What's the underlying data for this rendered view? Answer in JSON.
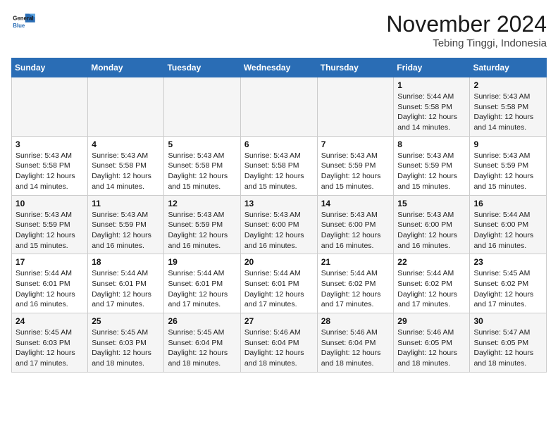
{
  "header": {
    "logo_line1": "General",
    "logo_line2": "Blue",
    "month": "November 2024",
    "location": "Tebing Tinggi, Indonesia"
  },
  "weekdays": [
    "Sunday",
    "Monday",
    "Tuesday",
    "Wednesday",
    "Thursday",
    "Friday",
    "Saturday"
  ],
  "weeks": [
    [
      {
        "day": "",
        "info": ""
      },
      {
        "day": "",
        "info": ""
      },
      {
        "day": "",
        "info": ""
      },
      {
        "day": "",
        "info": ""
      },
      {
        "day": "",
        "info": ""
      },
      {
        "day": "1",
        "info": "Sunrise: 5:44 AM\nSunset: 5:58 PM\nDaylight: 12 hours\nand 14 minutes."
      },
      {
        "day": "2",
        "info": "Sunrise: 5:43 AM\nSunset: 5:58 PM\nDaylight: 12 hours\nand 14 minutes."
      }
    ],
    [
      {
        "day": "3",
        "info": "Sunrise: 5:43 AM\nSunset: 5:58 PM\nDaylight: 12 hours\nand 14 minutes."
      },
      {
        "day": "4",
        "info": "Sunrise: 5:43 AM\nSunset: 5:58 PM\nDaylight: 12 hours\nand 14 minutes."
      },
      {
        "day": "5",
        "info": "Sunrise: 5:43 AM\nSunset: 5:58 PM\nDaylight: 12 hours\nand 15 minutes."
      },
      {
        "day": "6",
        "info": "Sunrise: 5:43 AM\nSunset: 5:58 PM\nDaylight: 12 hours\nand 15 minutes."
      },
      {
        "day": "7",
        "info": "Sunrise: 5:43 AM\nSunset: 5:59 PM\nDaylight: 12 hours\nand 15 minutes."
      },
      {
        "day": "8",
        "info": "Sunrise: 5:43 AM\nSunset: 5:59 PM\nDaylight: 12 hours\nand 15 minutes."
      },
      {
        "day": "9",
        "info": "Sunrise: 5:43 AM\nSunset: 5:59 PM\nDaylight: 12 hours\nand 15 minutes."
      }
    ],
    [
      {
        "day": "10",
        "info": "Sunrise: 5:43 AM\nSunset: 5:59 PM\nDaylight: 12 hours\nand 15 minutes."
      },
      {
        "day": "11",
        "info": "Sunrise: 5:43 AM\nSunset: 5:59 PM\nDaylight: 12 hours\nand 16 minutes."
      },
      {
        "day": "12",
        "info": "Sunrise: 5:43 AM\nSunset: 5:59 PM\nDaylight: 12 hours\nand 16 minutes."
      },
      {
        "day": "13",
        "info": "Sunrise: 5:43 AM\nSunset: 6:00 PM\nDaylight: 12 hours\nand 16 minutes."
      },
      {
        "day": "14",
        "info": "Sunrise: 5:43 AM\nSunset: 6:00 PM\nDaylight: 12 hours\nand 16 minutes."
      },
      {
        "day": "15",
        "info": "Sunrise: 5:43 AM\nSunset: 6:00 PM\nDaylight: 12 hours\nand 16 minutes."
      },
      {
        "day": "16",
        "info": "Sunrise: 5:44 AM\nSunset: 6:00 PM\nDaylight: 12 hours\nand 16 minutes."
      }
    ],
    [
      {
        "day": "17",
        "info": "Sunrise: 5:44 AM\nSunset: 6:01 PM\nDaylight: 12 hours\nand 16 minutes."
      },
      {
        "day": "18",
        "info": "Sunrise: 5:44 AM\nSunset: 6:01 PM\nDaylight: 12 hours\nand 17 minutes."
      },
      {
        "day": "19",
        "info": "Sunrise: 5:44 AM\nSunset: 6:01 PM\nDaylight: 12 hours\nand 17 minutes."
      },
      {
        "day": "20",
        "info": "Sunrise: 5:44 AM\nSunset: 6:01 PM\nDaylight: 12 hours\nand 17 minutes."
      },
      {
        "day": "21",
        "info": "Sunrise: 5:44 AM\nSunset: 6:02 PM\nDaylight: 12 hours\nand 17 minutes."
      },
      {
        "day": "22",
        "info": "Sunrise: 5:44 AM\nSunset: 6:02 PM\nDaylight: 12 hours\nand 17 minutes."
      },
      {
        "day": "23",
        "info": "Sunrise: 5:45 AM\nSunset: 6:02 PM\nDaylight: 12 hours\nand 17 minutes."
      }
    ],
    [
      {
        "day": "24",
        "info": "Sunrise: 5:45 AM\nSunset: 6:03 PM\nDaylight: 12 hours\nand 17 minutes."
      },
      {
        "day": "25",
        "info": "Sunrise: 5:45 AM\nSunset: 6:03 PM\nDaylight: 12 hours\nand 18 minutes."
      },
      {
        "day": "26",
        "info": "Sunrise: 5:45 AM\nSunset: 6:04 PM\nDaylight: 12 hours\nand 18 minutes."
      },
      {
        "day": "27",
        "info": "Sunrise: 5:46 AM\nSunset: 6:04 PM\nDaylight: 12 hours\nand 18 minutes."
      },
      {
        "day": "28",
        "info": "Sunrise: 5:46 AM\nSunset: 6:04 PM\nDaylight: 12 hours\nand 18 minutes."
      },
      {
        "day": "29",
        "info": "Sunrise: 5:46 AM\nSunset: 6:05 PM\nDaylight: 12 hours\nand 18 minutes."
      },
      {
        "day": "30",
        "info": "Sunrise: 5:47 AM\nSunset: 6:05 PM\nDaylight: 12 hours\nand 18 minutes."
      }
    ]
  ]
}
